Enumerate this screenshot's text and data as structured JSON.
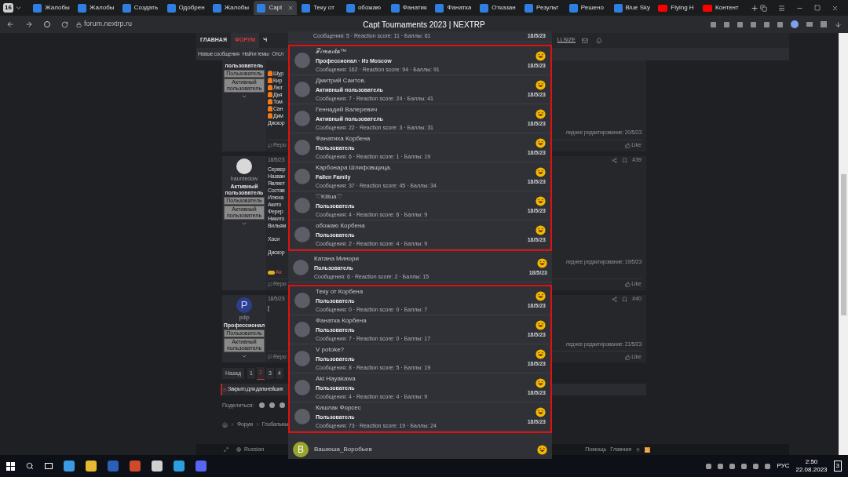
{
  "browser": {
    "tab_count": "16",
    "tabs": [
      {
        "title": "Жалобы",
        "kind": "forum",
        "selected": false
      },
      {
        "title": "Жалобы",
        "kind": "forum",
        "selected": false
      },
      {
        "title": "Создать",
        "kind": "forum",
        "selected": false
      },
      {
        "title": "Одобрен",
        "kind": "forum",
        "selected": false
      },
      {
        "title": "Жалобы",
        "kind": "forum",
        "selected": false
      },
      {
        "title": "Capt",
        "kind": "forum",
        "selected": true
      },
      {
        "title": "Теку от",
        "kind": "forum",
        "selected": false
      },
      {
        "title": "обожаю",
        "kind": "forum",
        "selected": false
      },
      {
        "title": "Фанатик",
        "kind": "forum",
        "selected": false
      },
      {
        "title": "Фанатка",
        "kind": "forum",
        "selected": false
      },
      {
        "title": "Отказан",
        "kind": "forum",
        "selected": false
      },
      {
        "title": "Результ",
        "kind": "forum",
        "selected": false
      },
      {
        "title": "Решено",
        "kind": "forum",
        "selected": false
      },
      {
        "title": "Blue Sky",
        "kind": "forum",
        "selected": false
      },
      {
        "title": "Flying H",
        "kind": "video",
        "selected": false
      },
      {
        "title": "Контент",
        "kind": "video",
        "selected": false
      }
    ],
    "url": "forum.nextrp.ru",
    "page_title": "Capt Tournaments 2023 | NEXTRP"
  },
  "forum": {
    "nav": [
      {
        "label": "ГЛАВНАЯ",
        "selected": false
      },
      {
        "label": "ФОРУМ",
        "selected": true
      },
      {
        "label": "Ч",
        "selected": false
      }
    ],
    "nav_right": "LLSIZE",
    "subnav": [
      "Новые сообщения",
      "Найти темы",
      "Отсл"
    ],
    "posts": [
      {
        "role": "пользователь",
        "badges": [
          "Пользователь",
          "Активный пользователь"
        ],
        "lines": [
          {
            "kind": "fire",
            "text": "Шур"
          },
          {
            "kind": "fire",
            "text": "Кир"
          },
          {
            "kind": "fire",
            "text": "Лют"
          },
          {
            "kind": "fire",
            "text": "Дья"
          },
          {
            "kind": "fire",
            "text": "Том"
          },
          {
            "kind": "fire",
            "text": "Сан"
          },
          {
            "kind": "fire",
            "text": "Дим"
          },
          {
            "kind": "text",
            "text": "Дискор"
          }
        ],
        "edited": "леднее редактирование: 20/5/23",
        "report": "Repo",
        "like": "Like"
      },
      {
        "username": "hauntedow",
        "role": "Активный пользователь",
        "badges": [
          "Пользователь",
          "Активный пользователь"
        ],
        "date": "18/5/23",
        "number": "#39",
        "lines": [
          {
            "kind": "text",
            "text": "Сервер"
          },
          {
            "kind": "text",
            "text": "Назван"
          },
          {
            "kind": "text",
            "text": "Являет"
          },
          {
            "kind": "text",
            "text": "Состав"
          },
          {
            "kind": "text",
            "text": "Илюха"
          },
          {
            "kind": "text",
            "text": "Акито"
          },
          {
            "kind": "text",
            "text": "Ферер"
          },
          {
            "kind": "text",
            "text": "Никито"
          },
          {
            "kind": "text",
            "text": "Вильям"
          },
          {
            "kind": "gap"
          },
          {
            "kind": "text",
            "text": "Хаси"
          },
          {
            "kind": "gap"
          },
          {
            "kind": "text",
            "text": "Дискор"
          }
        ],
        "edited": "леднее редактирование: 19/5/23",
        "reacted_by": "Ак",
        "report": "Repo",
        "like": "Like"
      },
      {
        "avatar_letter": "P",
        "username": "pdlp",
        "role": "Профессионал",
        "badges": [
          "Пользователь",
          "Активный пользователь"
        ],
        "date": "18/5/23",
        "number": "#40",
        "lines": [
          {
            "kind": "text",
            "text": "["
          }
        ],
        "edited": "леднее редактирование: 21/5/23",
        "report": "Repo",
        "like": "Like"
      }
    ],
    "pagination": {
      "back": "Назад",
      "pages": [
        {
          "label": "1",
          "selected": false
        },
        {
          "label": "2",
          "selected": true
        },
        {
          "label": "3",
          "selected": false
        },
        {
          "label": "4",
          "selected": false
        }
      ]
    },
    "closed_notice": "Закрыто для дальнейших",
    "share_label": "Поделиться:",
    "breadcrumbs": [
      "Форум",
      "Глобальны"
    ],
    "footer": {
      "language": "Russian",
      "links": [
        "Помощь",
        "Главная"
      ]
    }
  },
  "reactions": {
    "groups": [
      {
        "highlighted": false,
        "rows": [
          {
            "kind": "cut",
            "stats": "Сообщения: 5 · Reaction score: 11 · Баллы: 61",
            "date": "18/5/23"
          }
        ]
      },
      {
        "highlighted": true,
        "rows": [
          {
            "kind": "full",
            "name": "𝒯𝒾𝓂𝒶𝓇𝓀𝒶™",
            "title": "Профессионал · Из Moscow",
            "stats": "Сообщения: 162 · Reaction score: 94 · Баллы: 91",
            "date": "18/5/23"
          },
          {
            "kind": "full",
            "name": "Дмитрий Саитов.",
            "title": "Активный пользователь",
            "stats": "Сообщения: 7 · Reaction score: 24 · Баллы: 41",
            "date": "18/5/23"
          },
          {
            "kind": "full",
            "name": "Геннадий Валеревич",
            "title": "Активный пользователь",
            "stats": "Сообщения: 22 · Reaction score: 3 · Баллы: 31",
            "date": "18/5/23"
          },
          {
            "kind": "full",
            "name": "Фанатиха Корбена",
            "title": "Пользователь",
            "stats": "Сообщения: 6 · Reaction score: 1 · Баллы: 19",
            "date": "18/5/23"
          },
          {
            "kind": "full",
            "name": "Карбонара Шлифовщица.",
            "title": "Fallen Family",
            "stats": "Сообщения: 37 · Reaction score: 45 · Баллы: 34",
            "date": "18/5/23"
          },
          {
            "kind": "full",
            "name": "♡Killua♡",
            "title": "Пользователь",
            "stats": "Сообщения: 4 · Reaction score: 6 · Баллы: 9",
            "date": "18/5/23"
          },
          {
            "kind": "full",
            "name": "обожаю Корбена",
            "title": "Пользователь",
            "stats": "Сообщения: 2 · Reaction score: 4 · Баллы: 9",
            "date": "18/5/23"
          }
        ]
      },
      {
        "highlighted": false,
        "rows": [
          {
            "kind": "full",
            "name": "Катана Минори",
            "title": "Пользователь",
            "stats": "Сообщения: 6 · Reaction score: 2 · Баллы: 15",
            "date": "18/5/23"
          }
        ]
      },
      {
        "highlighted": true,
        "rows": [
          {
            "kind": "full",
            "name": "Теку от Корбена",
            "title": "Пользователь",
            "stats": "Сообщения: 0 · Reaction score: 0 · Баллы: 7",
            "date": "18/5/23"
          },
          {
            "kind": "full",
            "name": "Фанатка Корбена",
            "title": "Пользователь",
            "stats": "Сообщения: 7 · Reaction score: 0 · Баллы: 17",
            "date": "18/5/23"
          },
          {
            "kind": "full",
            "name": "V potoke?",
            "title": "Пользователь",
            "stats": "Сообщения: 8 · Reaction score: 5 · Баллы: 19",
            "date": "18/5/23"
          },
          {
            "kind": "full",
            "name": "Aki Hayakawa",
            "title": "Пользователь",
            "stats": "Сообщения: 4 · Reaction score: 4 · Баллы: 9",
            "date": "18/5/23"
          },
          {
            "kind": "full",
            "name": "Кишлак Форсес",
            "title": "Пользователь",
            "stats": "Сообщения: 73 · Reaction score: 19 · Баллы: 24",
            "date": "18/5/23"
          }
        ]
      },
      {
        "highlighted": false,
        "rows": [
          {
            "kind": "full",
            "name": "Вашюша_Воробьев",
            "avatar_letter": "B"
          }
        ]
      }
    ]
  },
  "taskbar": {
    "language": "РУС",
    "time": "2:50",
    "date": "22.08.2023",
    "notifications": "3"
  }
}
